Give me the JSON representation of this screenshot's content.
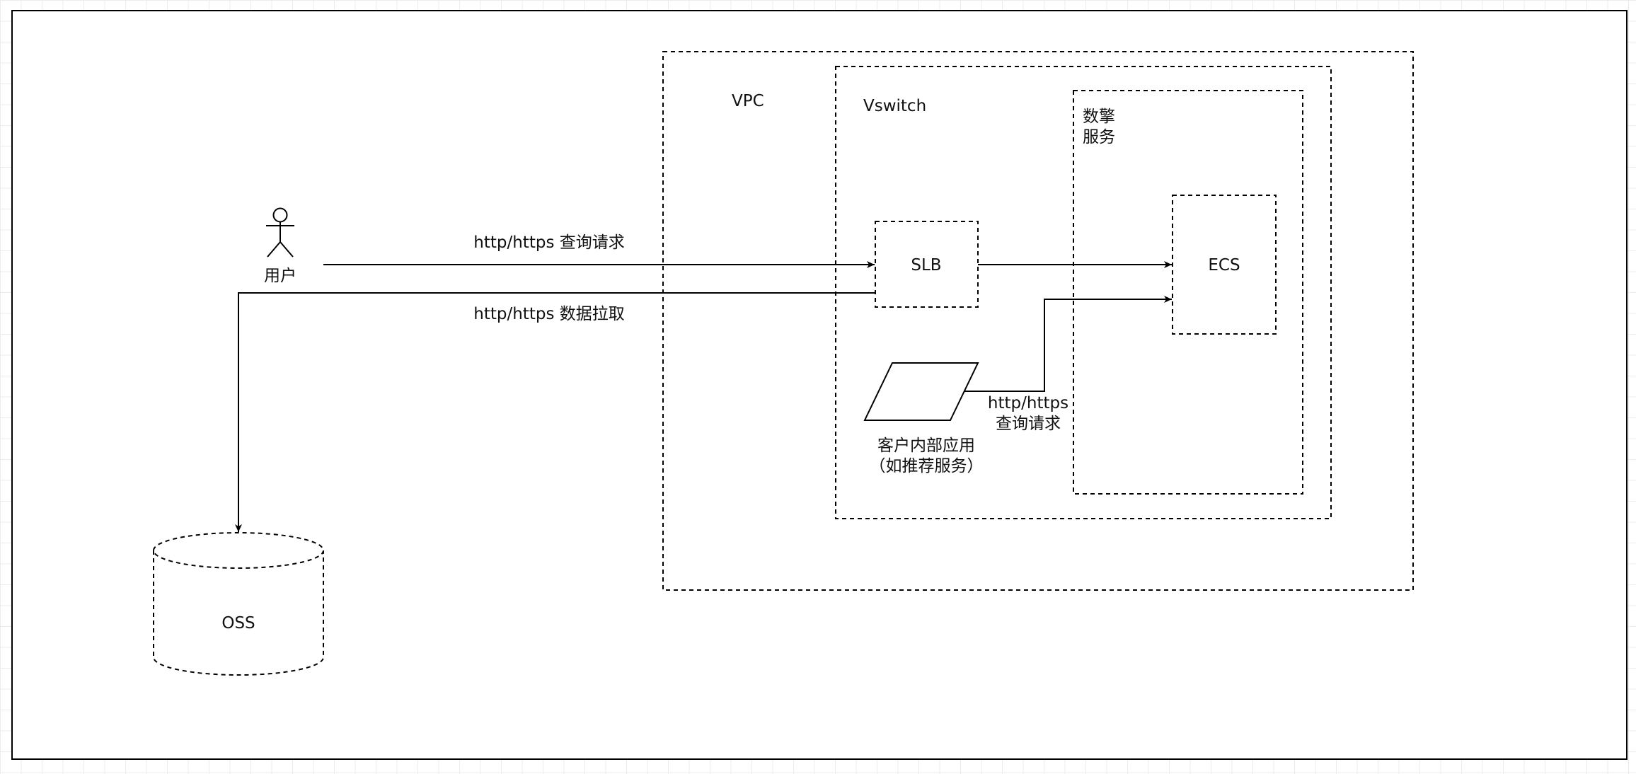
{
  "labels": {
    "vpc": "VPC",
    "vswitch": "Vswitch",
    "service_line1": "数擎",
    "service_line2": "服务",
    "slb": "SLB",
    "ecs": "ECS",
    "user": "用户",
    "oss": "OSS",
    "app_line1": "客户内部应用",
    "app_line2": "（如推荐服务）"
  },
  "edges": {
    "user_to_slb": "http/https 查询请求",
    "slb_to_oss": "http/https 数据拉取",
    "app_to_ecs_line1": "http/https",
    "app_to_ecs_line2": "查询请求"
  }
}
